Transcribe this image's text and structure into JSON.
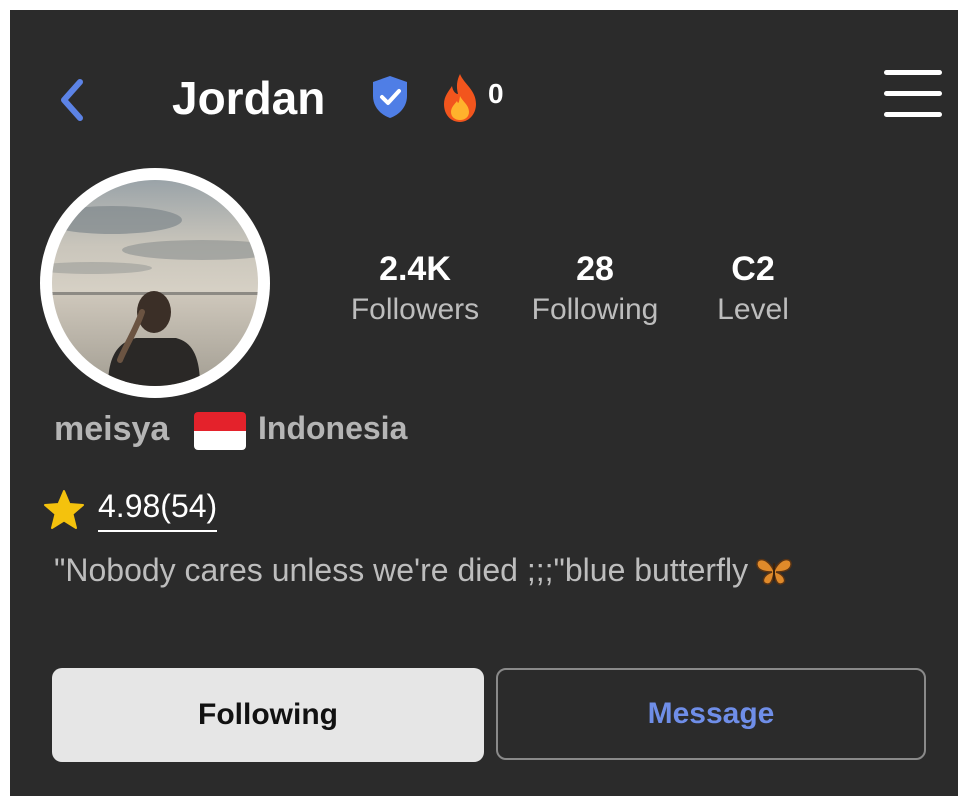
{
  "header": {
    "title": "Jordan",
    "streak_count": "0",
    "icons": {
      "back": "chevron-left-icon",
      "verified": "verified-shield-icon",
      "streak": "fire-icon",
      "menu": "hamburger-menu-icon"
    }
  },
  "profile": {
    "avatar": "profile-photo",
    "stats": [
      {
        "value": "2.4K",
        "label": "Followers"
      },
      {
        "value": "28",
        "label": "Following"
      },
      {
        "value": "C2",
        "label": "Level"
      }
    ],
    "username": "meisya",
    "country": "Indonesia",
    "flag": "indonesia-flag-icon",
    "rating": "4.98(54)",
    "bio": "\"Nobody cares unless we're died ;;;\"blue butterfly"
  },
  "actions": {
    "following_label": "Following",
    "message_label": "Message"
  },
  "colors": {
    "background": "#2b2b2b",
    "accent": "#6f8ee8",
    "verified": "#4f7ee6",
    "star": "#f4c20d",
    "following_button_bg": "#e6e6e6"
  }
}
